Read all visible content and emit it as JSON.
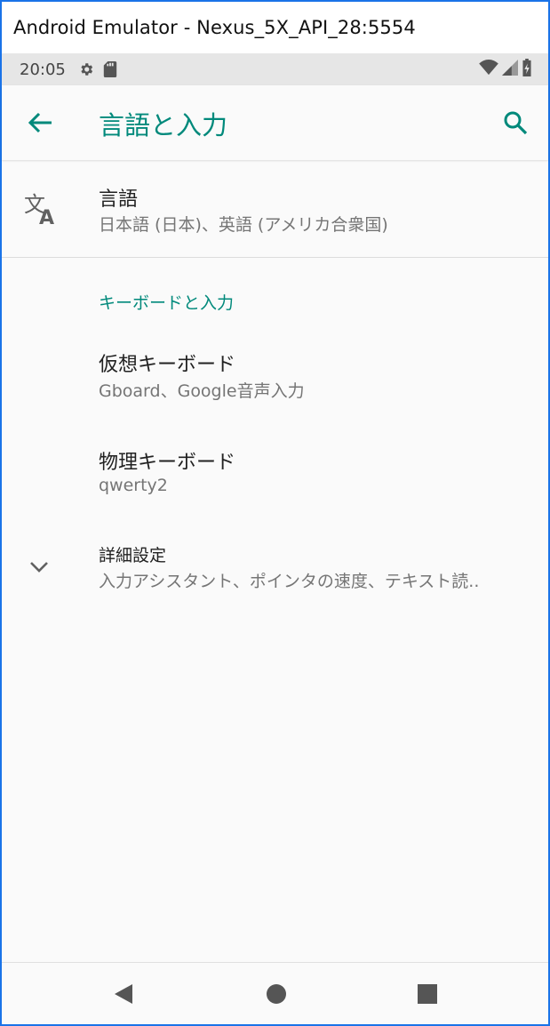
{
  "window": {
    "title": "Android Emulator - Nexus_5X_API_28:5554"
  },
  "status_bar": {
    "time": "20:05",
    "icons_left": [
      "settings-gear-icon",
      "sd-card-icon"
    ],
    "icons_right": [
      "wifi-icon",
      "cellular-signal-icon",
      "battery-icon"
    ]
  },
  "app_bar": {
    "title": "言語と入力",
    "back_icon": "arrow-back-icon",
    "search_icon": "search-icon"
  },
  "colors": {
    "accent": "#00897b",
    "text_primary": "#212121",
    "text_secondary": "#757575",
    "background": "#fafafa"
  },
  "items": {
    "language": {
      "title": "言語",
      "summary": "日本語 (日本)、英語 (アメリカ合衆国)",
      "icon": "translate-icon"
    },
    "section_keyboard": {
      "header": "キーボードと入力"
    },
    "virtual_keyboard": {
      "title": "仮想キーボード",
      "summary": "Gboard、Google音声入力"
    },
    "physical_keyboard": {
      "title": "物理キーボード",
      "summary": "qwerty2"
    },
    "advanced": {
      "title": "詳細設定",
      "summary": "入力アシスタント、ポインタの速度、テキスト読..",
      "icon": "chevron-down-icon"
    }
  },
  "nav_bar": {
    "buttons": [
      "back-triangle-icon",
      "home-circle-icon",
      "recents-square-icon"
    ]
  }
}
